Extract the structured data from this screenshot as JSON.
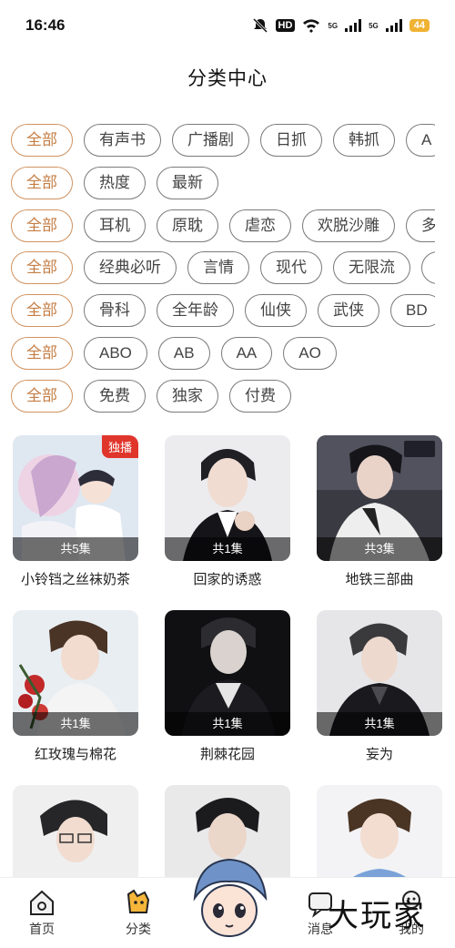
{
  "status": {
    "time": "16:46",
    "network_hd": "HD",
    "net1": "5G",
    "net2": "5G",
    "battery": "44"
  },
  "page_title": "分类中心",
  "filters": [
    {
      "active": "全部",
      "chips": [
        "有声书",
        "广播剧",
        "日抓",
        "韩抓",
        "A"
      ]
    },
    {
      "active": "全部",
      "chips": [
        "热度",
        "最新"
      ]
    },
    {
      "active": "全部",
      "chips": [
        "耳机",
        "原耽",
        "虐恋",
        "欢脱沙雕",
        "多"
      ]
    },
    {
      "active": "全部",
      "chips": [
        "经典必听",
        "言情",
        "现代",
        "无限流",
        "C"
      ]
    },
    {
      "active": "全部",
      "chips": [
        "骨科",
        "全年龄",
        "仙侠",
        "武侠",
        "BD"
      ]
    },
    {
      "active": "全部",
      "chips": [
        "ABO",
        "AB",
        "AA",
        "AO"
      ]
    },
    {
      "active": "全部",
      "chips": [
        "免费",
        "独家",
        "付费"
      ]
    }
  ],
  "cards": [
    {
      "title": "小铃铛之丝袜奶茶",
      "episodes": "共5集",
      "badge": "独播"
    },
    {
      "title": "回家的诱惑",
      "episodes": "共1集",
      "badge": ""
    },
    {
      "title": "地铁三部曲",
      "episodes": "共3集",
      "badge": ""
    },
    {
      "title": "红玫瑰与棉花",
      "episodes": "共1集",
      "badge": ""
    },
    {
      "title": "荆棘花园",
      "episodes": "共1集",
      "badge": ""
    },
    {
      "title": "妄为",
      "episodes": "共1集",
      "badge": ""
    },
    {
      "title": "",
      "episodes": "",
      "badge": ""
    },
    {
      "title": "",
      "episodes": "",
      "badge": ""
    },
    {
      "title": "",
      "episodes": "",
      "badge": ""
    }
  ],
  "nav": {
    "home": "首页",
    "category": "分类",
    "messages": "消息",
    "mine": "我的"
  },
  "watermark": "大玩家",
  "colors": {
    "accent": "#c47e45",
    "badge": "#e0352b"
  }
}
